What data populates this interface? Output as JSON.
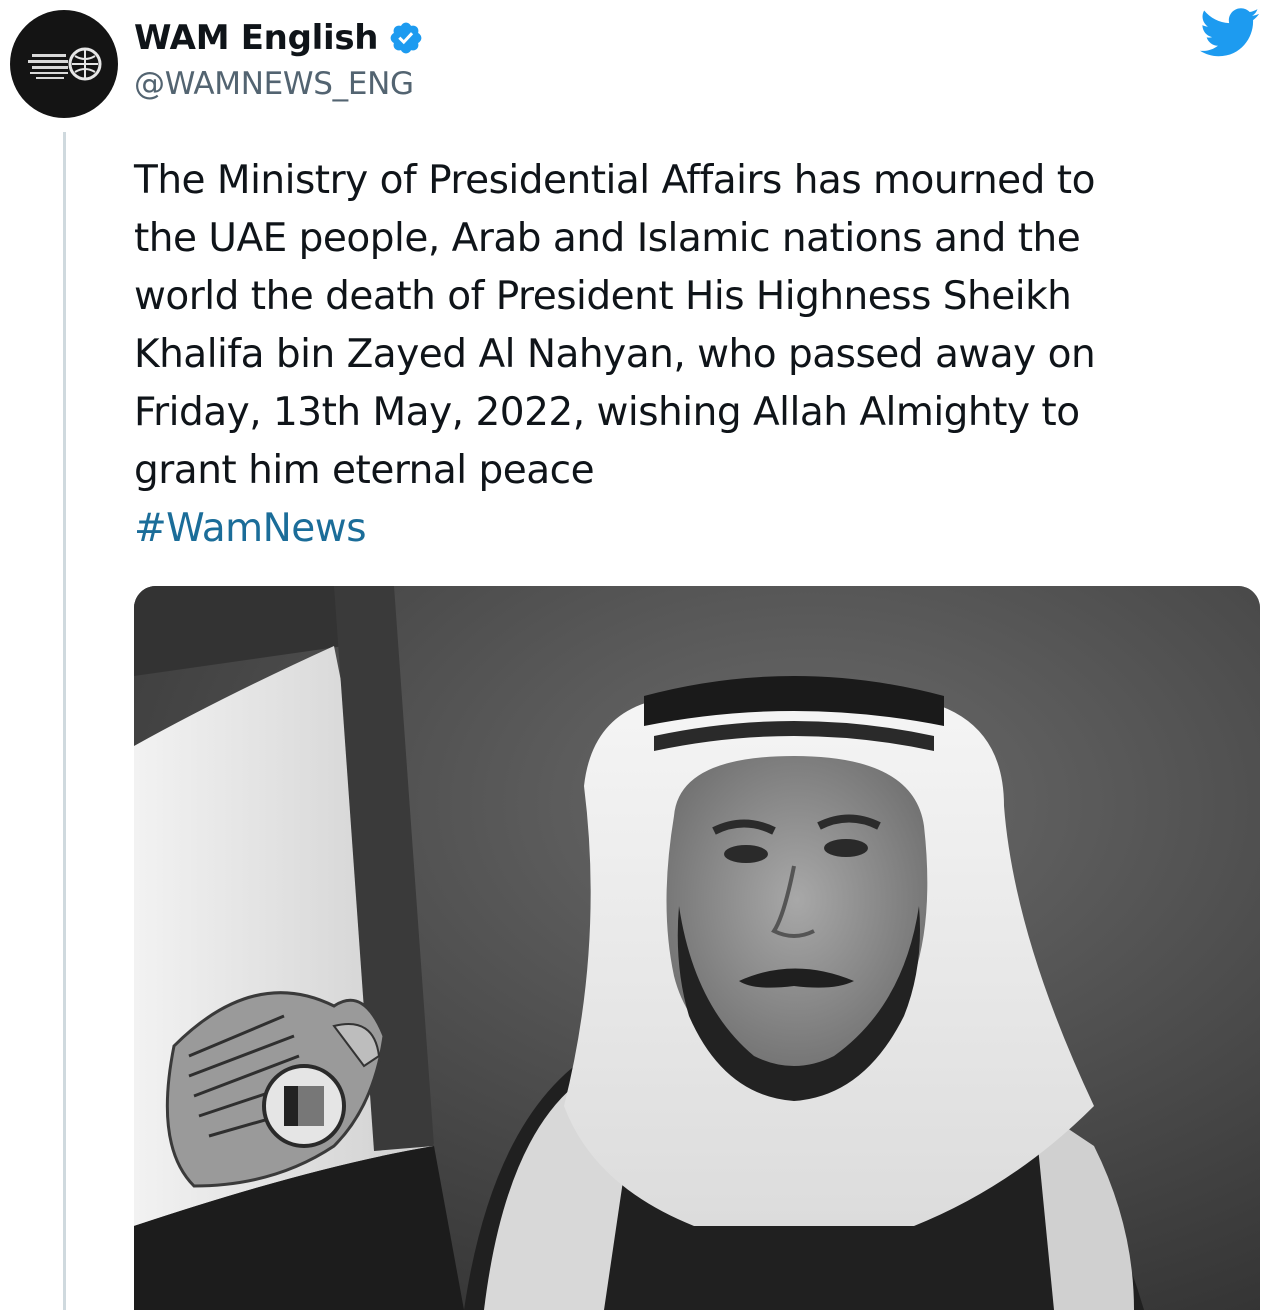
{
  "author": {
    "display_name": "WAM English",
    "handle": "@WAMNEWS_ENG",
    "verified": true,
    "avatar_icon": "wam-logo-icon"
  },
  "platform_icon": "twitter-bird-icon",
  "tweet": {
    "text_lines": [
      "The Ministry of Presidential Affairs has mourned to",
      "the UAE people, Arab and Islamic nations and the",
      "world the death of President His Highness Sheikh",
      "Khalifa bin Zayed Al Nahyan, who passed away on",
      "Friday, 13th May, 2022, wishing Allah Almighty to",
      "grant him eternal peace"
    ],
    "hashtag": "#WamNews"
  },
  "media": {
    "type": "photo",
    "style": "black-and-white portrait with UAE flag and emblem"
  },
  "colors": {
    "text": "#0f1419",
    "secondary": "#536471",
    "link": "#1b6d99",
    "twitter_blue": "#1d9bf0"
  }
}
